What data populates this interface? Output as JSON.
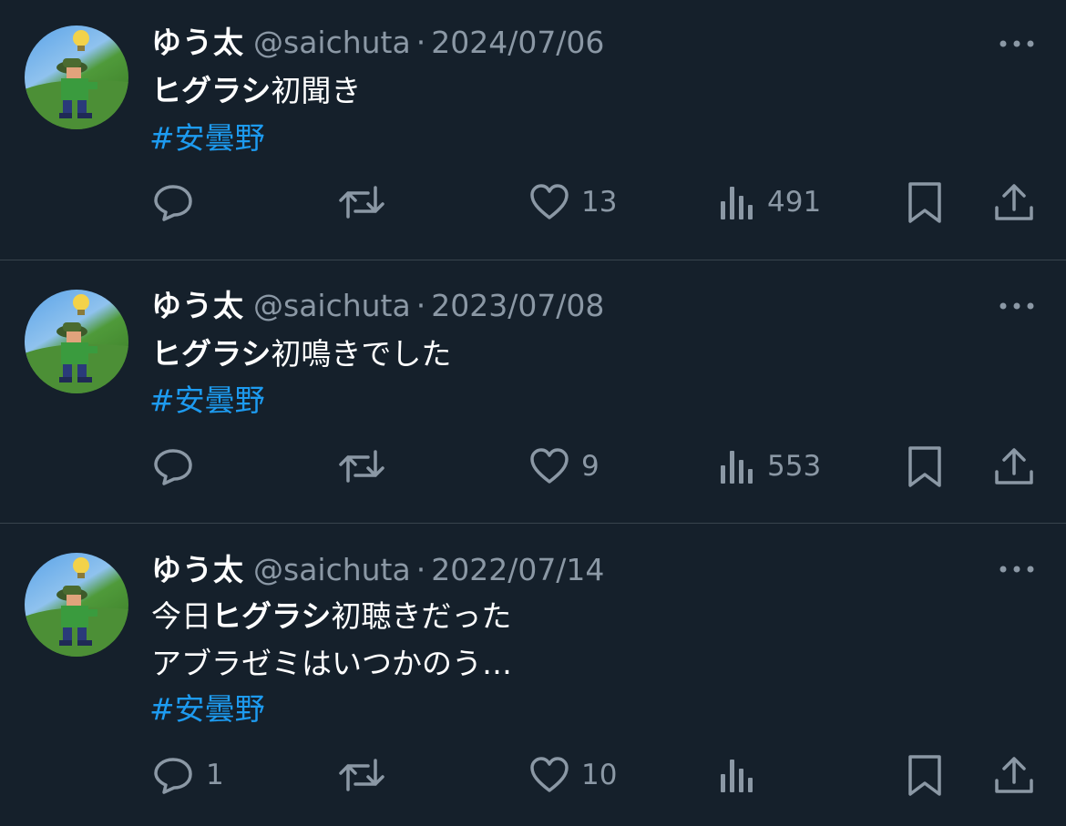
{
  "colors": {
    "background": "#15202b",
    "divider": "#38444d",
    "text_primary": "#ffffff",
    "text_secondary": "#8b98a5",
    "hashtag": "#1d9bf0"
  },
  "icons": {
    "more": "more-horizontal-icon",
    "reply": "reply-icon",
    "retweet": "retweet-icon",
    "like": "heart-icon",
    "views": "views-chart-icon",
    "bookmark": "bookmark-icon",
    "share": "share-icon"
  },
  "tweets": [
    {
      "display_name": "ゆう太",
      "handle": "@saichuta",
      "separator": "·",
      "date": "2024/07/06",
      "text_bold": "ヒグラシ",
      "text_rest": "初聞き",
      "hashtag": "#安曇野",
      "replies": "",
      "likes": "13",
      "views": "491"
    },
    {
      "display_name": "ゆう太",
      "handle": "@saichuta",
      "separator": "·",
      "date": "2023/07/08",
      "text_bold": "ヒグラシ",
      "text_rest": "初鳴きでした",
      "hashtag": "#安曇野",
      "replies": "",
      "likes": "9",
      "views": "553"
    },
    {
      "display_name": "ゆう太",
      "handle": "@saichuta",
      "separator": "·",
      "date": "2022/07/14",
      "text_pre": "今日",
      "text_bold": "ヒグラシ",
      "text_rest": "初聴きだった",
      "text_line2": "アブラゼミはいつかのう…",
      "hashtag": "#安曇野",
      "replies": "1",
      "likes": "10",
      "views": ""
    }
  ]
}
